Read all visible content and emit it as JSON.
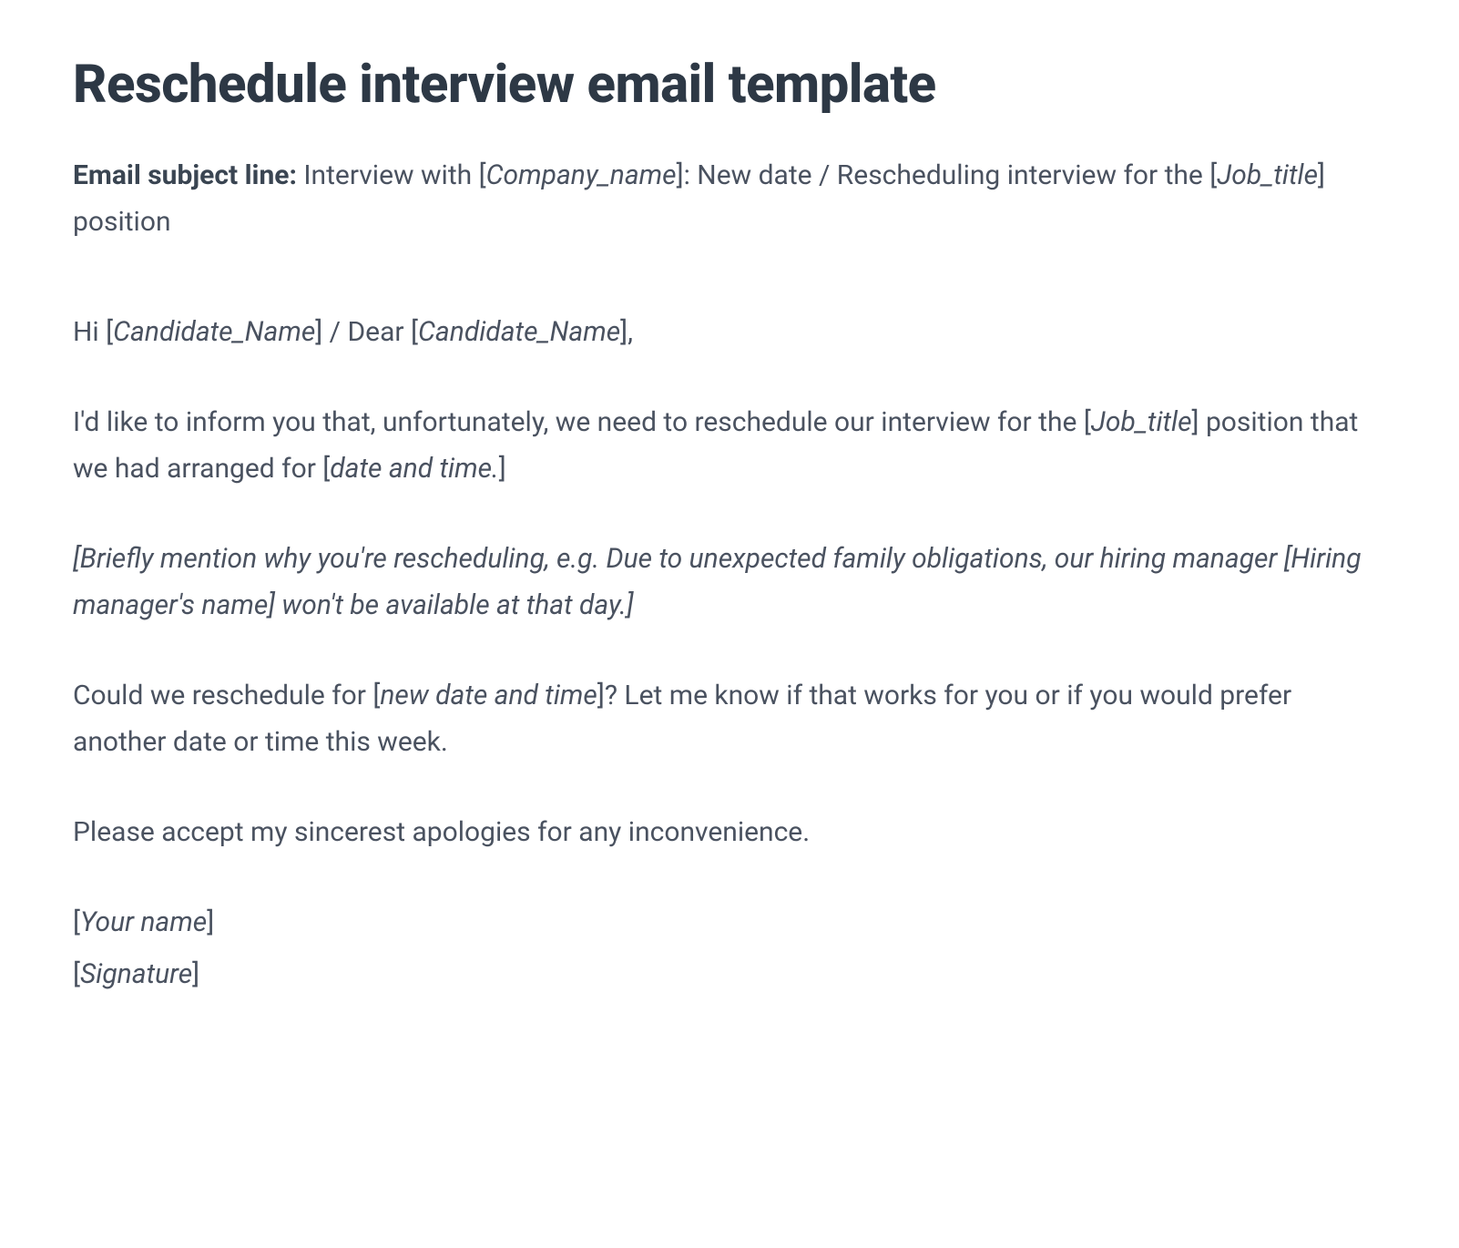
{
  "title": "Reschedule interview email template",
  "subject": {
    "label": "Email subject line:",
    "pre1": " Interview with [",
    "ph1": "Company_name",
    "mid1": "]: New date / Rescheduling interview for the [",
    "ph2": "Job_title",
    "post1": "] position"
  },
  "greeting": {
    "pre1": "Hi [",
    "ph1": "Candidate_Name",
    "mid1": "] / Dear [",
    "ph2": "Candidate_Name",
    "post1": "],"
  },
  "para1": {
    "pre1": "I'd like to inform you that, unfortunately, we need to reschedule our interview for the [",
    "ph1": "Job_title",
    "mid1": "] position that we had arranged for [",
    "ph2": "date and time.",
    "post1": "]"
  },
  "para2": {
    "pre1": "[",
    "ph1": "Briefly mention why you're rescheduling, e.g. Due to unexpected family obligations, our hiring manager [Hiring manager's name] won't be available at that day.",
    "post1": "]"
  },
  "para3": {
    "pre1": "Could we reschedule for [",
    "ph1": "new date and time",
    "post1": "]? Let me know if that works for you or if you would prefer another date or time this week."
  },
  "para4": "Please accept my sincerest apologies for any inconvenience.",
  "sig1": {
    "pre": "[",
    "ph": "Your name",
    "post": "]"
  },
  "sig2": {
    "pre": "[",
    "ph": "Signature",
    "post": "]"
  }
}
